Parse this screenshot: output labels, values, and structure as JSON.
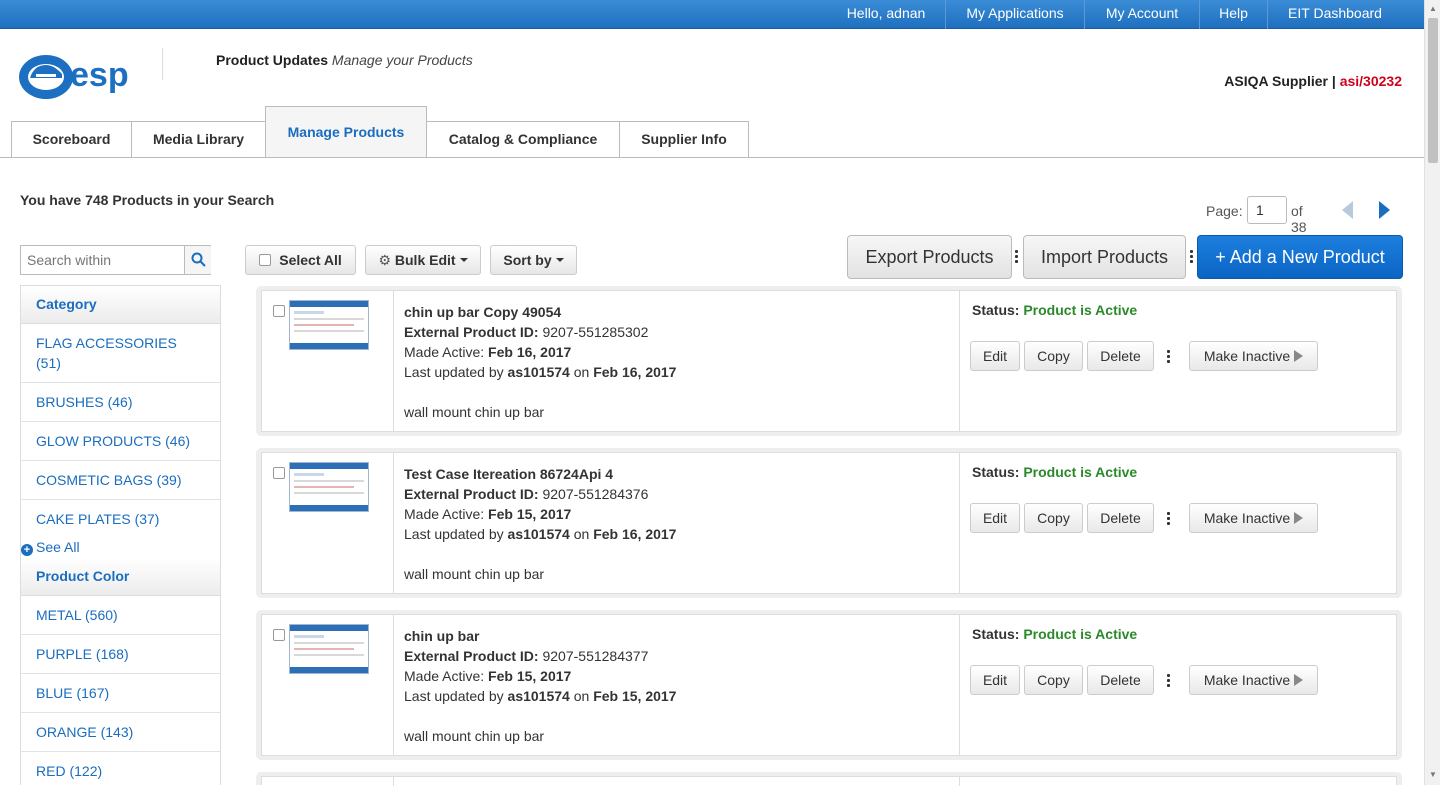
{
  "topnav": {
    "greeting": "Hello, adnan",
    "items": [
      "My Applications",
      "My Account",
      "Help",
      "EIT Dashboard"
    ]
  },
  "header": {
    "logo_text": "esp",
    "section_title": "Product Updates",
    "section_subtitle": "Manage your Products",
    "supplier_label": "ASIQA Supplier",
    "supplier_sep": "|",
    "supplier_id": "asi/30232"
  },
  "tabs": [
    "Scoreboard",
    "Media Library",
    "Manage Products",
    "Catalog & Compliance",
    "Supplier Info"
  ],
  "active_tab": "Manage Products",
  "results": {
    "summary": "You have 748 Products in your Search"
  },
  "pager": {
    "label": "Page:",
    "current": "1",
    "of_text": "of 38"
  },
  "search": {
    "placeholder": "Search within"
  },
  "filters": {
    "category_title": "Category",
    "categories": [
      {
        "name": "FLAG ACCESSORIES",
        "count": "(51)"
      },
      {
        "name": "BRUSHES",
        "count": "(46)"
      },
      {
        "name": "GLOW PRODUCTS",
        "count": "(46)"
      },
      {
        "name": "COSMETIC BAGS",
        "count": "(39)"
      },
      {
        "name": "CAKE PLATES",
        "count": "(37)"
      }
    ],
    "see_all": "See All",
    "color_title": "Product Color",
    "colors": [
      {
        "name": "METAL",
        "count": "(560)"
      },
      {
        "name": "PURPLE",
        "count": "(168)"
      },
      {
        "name": "BLUE",
        "count": "(167)"
      },
      {
        "name": "ORANGE",
        "count": "(143)"
      },
      {
        "name": "RED",
        "count": "(122)"
      }
    ]
  },
  "toolbar": {
    "select_all": "Select All",
    "bulk_edit": "Bulk Edit",
    "sort_by": "Sort by",
    "export": "Export Products",
    "import": "Import Products",
    "add_new": "+ Add a New Product"
  },
  "labels": {
    "external_id": "External Product ID:",
    "made_active": "Made Active:",
    "last_updated_by": "Last updated by",
    "on": "on",
    "status": "Status:",
    "edit": "Edit",
    "copy": "Copy",
    "delete": "Delete",
    "make_inactive": "Make Inactive"
  },
  "products": [
    {
      "name": "chin up bar Copy 49054",
      "external_id": "9207-551285302",
      "made_active": "Feb 16, 2017",
      "updated_by": "as101574",
      "updated_on": "Feb 16, 2017",
      "description": "wall mount chin up bar",
      "status": "Product is Active"
    },
    {
      "name": "Test Case Itereation 86724Api 4",
      "external_id": "9207-551284376",
      "made_active": "Feb 15, 2017",
      "updated_by": "as101574",
      "updated_on": "Feb 16, 2017",
      "description": "wall mount chin up bar",
      "status": "Product is Active"
    },
    {
      "name": "chin up bar",
      "external_id": "9207-551284377",
      "made_active": "Feb 15, 2017",
      "updated_by": "as101574",
      "updated_on": "Feb 15, 2017",
      "description": "wall mount chin up bar",
      "status": "Product is Active"
    }
  ],
  "colors": {
    "brand_blue": "#1a6dbf",
    "topbar": "#1f6fbf",
    "active_green": "#2a8a2a",
    "supplier_red": "#d0021b"
  },
  "icons": {
    "search": "search-icon",
    "gear": "gear-icon",
    "prev": "prev-page-icon",
    "next": "next-page-icon",
    "plus": "plus-circle-icon",
    "kebab": "more-vertical-icon",
    "play": "play-arrow-icon"
  }
}
